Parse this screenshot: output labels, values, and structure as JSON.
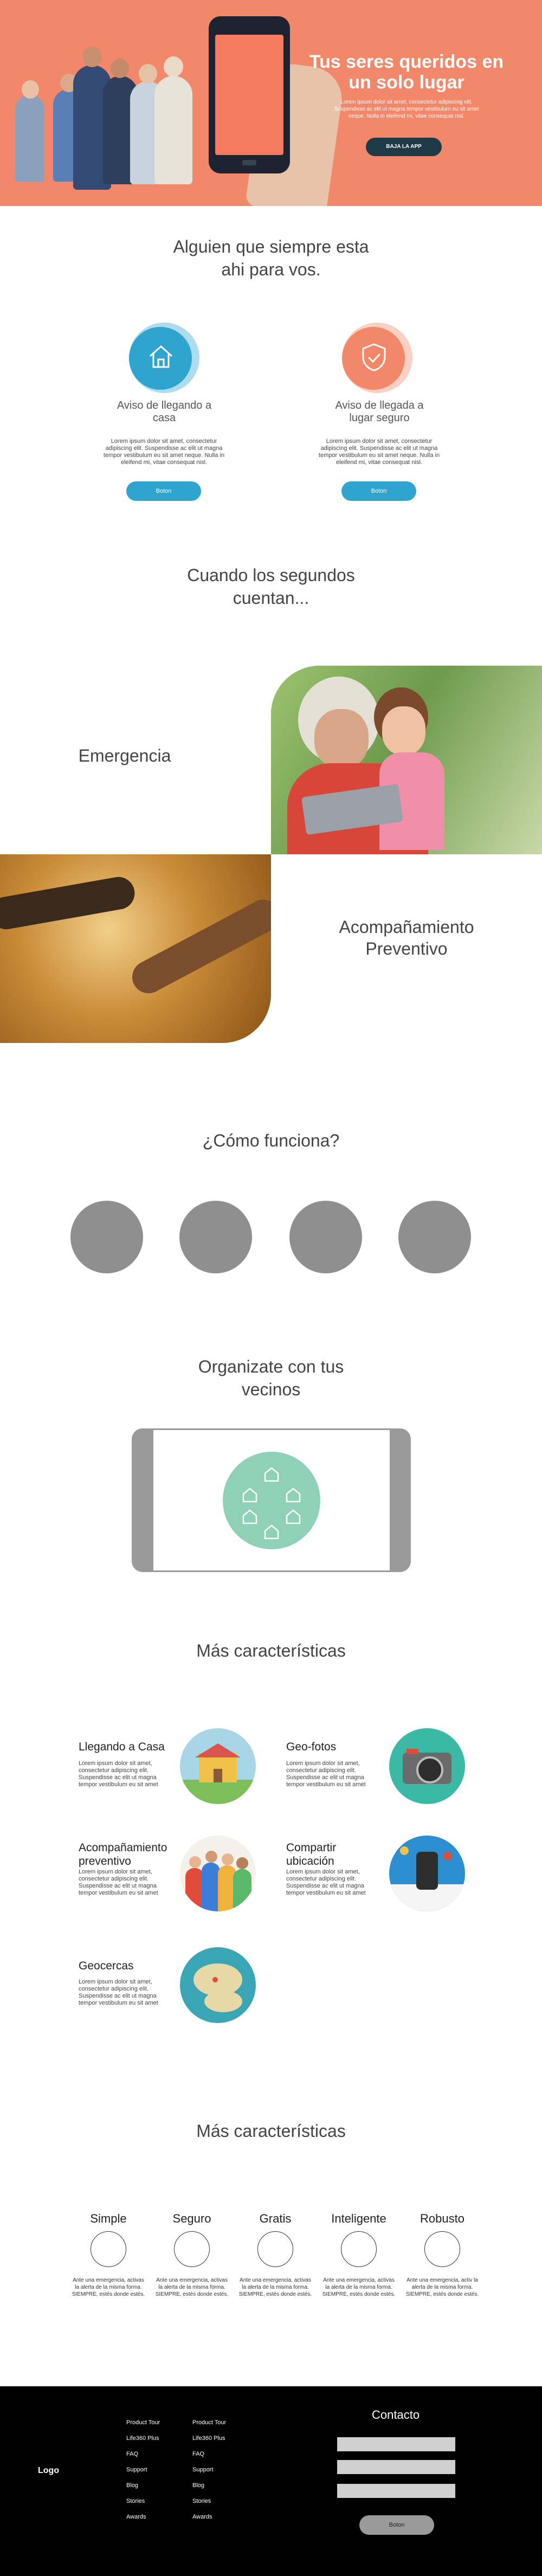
{
  "hero": {
    "title": "Tus seres queridos en un solo lugar",
    "description": "Lorem ipsum dolor sit amet, consectetur adipiscing elit. Suspendisse ac elit ut magna tempor vestibulum eu sit amet neque. Nulla in eleifend mi, vitae consequat nisl.",
    "button_label": "BAJA LA APP"
  },
  "intro": {
    "title": "Alguien que siempre esta ahi para vos."
  },
  "features": [
    {
      "title": "Aviso de llegando a casa",
      "text": "Lorem ipsum dolor sit amet, consectetur adipiscing elit. Suspendisse ac elit ut magna tempor vestibulum eu sit amet neque. Nulla in eleifend mi, vitae consequat nisl.",
      "button": "Boton",
      "icon": "home-icon",
      "color": "#2fa4cf"
    },
    {
      "title": "Aviso de llegada a lugar seguro",
      "text": "Lorem ipsum dolor sit amet, consectetur adipiscing elit. Suspendisse ac elit ut magna tempor vestibulum eu sit amet neque. Nulla in eleifend mi, vitae consequat nisl.",
      "button": "Boton",
      "icon": "shield-icon",
      "color": "#f2876a"
    }
  ],
  "seconds": {
    "title": "Cuando los segundos cuentan..."
  },
  "emergency": {
    "label": "Emergencia"
  },
  "preventive": {
    "label": "Acompañamiento Preventivo"
  },
  "how": {
    "title": "¿Cómo funciona?"
  },
  "neighbors": {
    "title": "Organizate con tus vecinos"
  },
  "more1": {
    "title": "Más características",
    "items": [
      {
        "title": "Llegando a Casa",
        "text": "Lorem ipsum dolor sit amet, consectetur adipiscing elit. Suspendisse ac elit ut magna tempor vestibulum eu sit amet"
      },
      {
        "title": "Geo-fotos",
        "text": "Lorem ipsum dolor sit amet, consectetur adipiscing elit. Suspendisse ac elit ut magna tempor vestibulum eu sit amet"
      },
      {
        "title": "Acompañamiento preventivo",
        "text": "Lorem ipsum dolor sit amet, consectetur adipiscing elit. Suspendisse ac elit ut magna tempor vestibulum eu sit amet"
      },
      {
        "title": "Compartir ubicación",
        "text": "Lorem ipsum dolor sit amet, consectetur adipiscing elit. Suspendisse ac elit ut magna tempor vestibulum eu sit amet"
      },
      {
        "title": "Geocercas",
        "text": "Lorem ipsum dolor sit amet, consectetur adipiscing elit. Suspendisse ac elit ut magna tempor vestibulum eu sit amet"
      }
    ]
  },
  "more2": {
    "title": "Más características",
    "columns": [
      {
        "title": "Simple",
        "text": "Ante una emergencia, activas la alerta de la misma forma. SIEMPRE, estés donde estés."
      },
      {
        "title": "Seguro",
        "text": "Ante una emergencia, activas la alerta de la misma forma. SIEMPRE, estés donde estés."
      },
      {
        "title": "Gratis",
        "text": "Ante una emergencia, activas la alerta de la misma forma. SIEMPRE, estés donde estés."
      },
      {
        "title": "Inteligente",
        "text": "Ante una emergencia, activas la alerta de la misma forma. SIEMPRE, estés donde estés."
      },
      {
        "title": "Robusto",
        "text": "Ante una emergencia, activ la alerta de la misma forma. SIEMPRE, estés donde estés."
      }
    ]
  },
  "footer": {
    "logo": "Logo",
    "links_col1": [
      "Product Tour",
      "Life360 Plus",
      "FAQ",
      "Support",
      "Blog",
      "Stories",
      "Awards"
    ],
    "links_col2": [
      "Product Tour",
      "Life360 Plus",
      "FAQ",
      "Support",
      "Blog",
      "Stories",
      "Awards"
    ],
    "contact_title": "Contacto",
    "submit_label": "Boton"
  }
}
